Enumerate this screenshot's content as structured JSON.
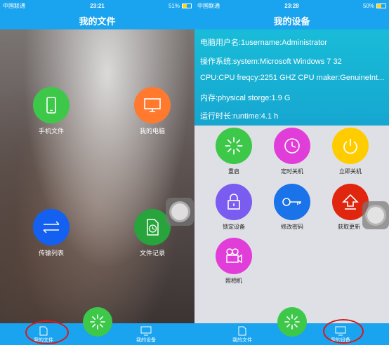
{
  "left": {
    "status": {
      "carrier": "中国联通",
      "time": "23:21",
      "battery": "51%",
      "battery_level": 0.51
    },
    "title": "我的文件",
    "items": [
      {
        "label": "手机文件",
        "icon": "phone-icon",
        "color": "#3ec84a"
      },
      {
        "label": "我的电脑",
        "icon": "monitor-icon",
        "color": "#ff7a2e"
      },
      {
        "label": "传输列表",
        "icon": "transfer-arrows-icon",
        "color": "#1460f0"
      },
      {
        "label": "文件记录",
        "icon": "file-clock-icon",
        "color": "#27a43b"
      }
    ],
    "tabs": [
      {
        "label": "我的文件",
        "icon": "file-icon"
      },
      {
        "label": "我的设备",
        "icon": "monitor-icon"
      }
    ]
  },
  "right": {
    "status": {
      "carrier": "中国联通",
      "time": "23:28",
      "battery": "50%",
      "battery_level": 0.5
    },
    "title": "我的设备",
    "info": [
      "电脑用户名:1username:Administrator",
      "操作系统:system:Microsoft Windows 7 32",
      "CPU:CPU freqcy:2251 GHZ CPU maker:GenuineInt...",
      "内存:physical storge:1.9 G",
      "运行时长:runtime:4.1 h"
    ],
    "actions": [
      {
        "label": "重启",
        "icon": "restart-burst-icon",
        "color": "#3ec84a"
      },
      {
        "label": "定时关机",
        "icon": "clock-icon",
        "color": "#e13ed9"
      },
      {
        "label": "立即关机",
        "icon": "power-icon",
        "color": "#ffcc00"
      },
      {
        "label": "锁定设备",
        "icon": "lock-icon",
        "color": "#7b5cf0"
      },
      {
        "label": "修改密码",
        "icon": "key-icon",
        "color": "#1a73e8"
      },
      {
        "label": "获取更新",
        "icon": "upload-arrow-icon",
        "color": "#e0260e"
      },
      {
        "label": "照相机",
        "icon": "video-camera-icon",
        "color": "#e13ed9"
      }
    ],
    "tabs": [
      {
        "label": "我的文件",
        "icon": "file-icon"
      },
      {
        "label": "我的设备",
        "icon": "monitor-icon"
      }
    ]
  }
}
